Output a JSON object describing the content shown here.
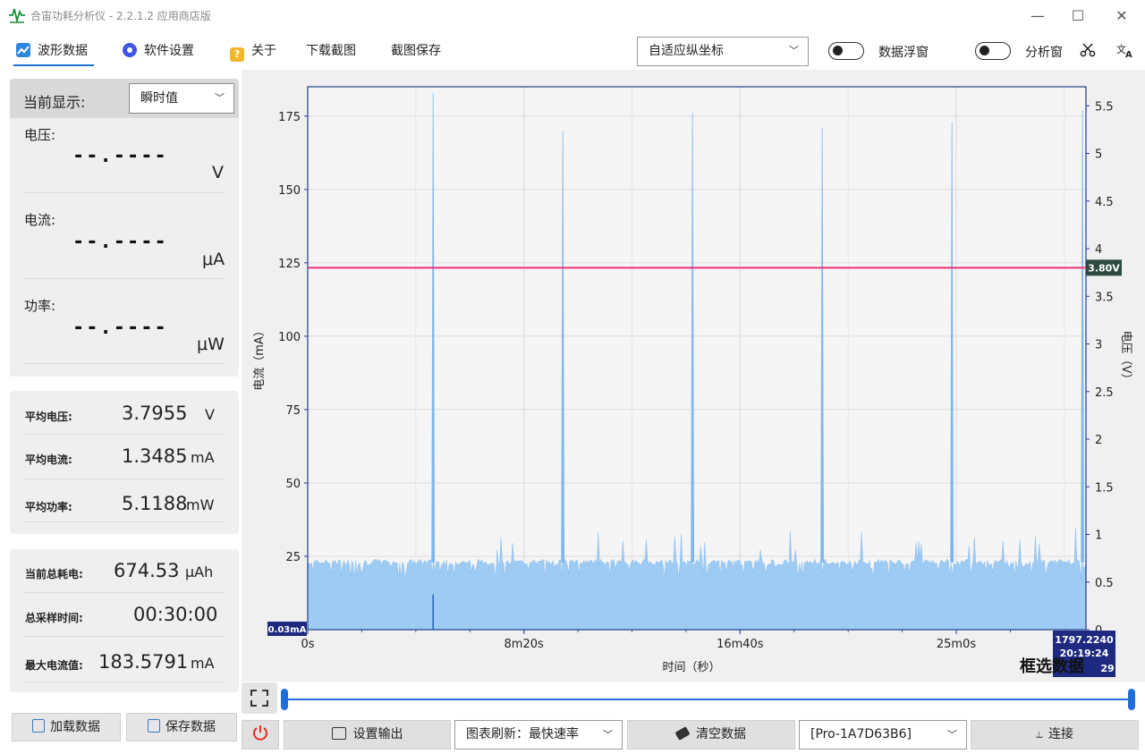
{
  "window": {
    "title": "合宙功耗分析仪 - 2.2.1.2 应用商店版"
  },
  "toolbar": {
    "tabs": [
      {
        "label": "波形数据"
      },
      {
        "label": "软件设置"
      },
      {
        "label": "关于"
      },
      {
        "label": "下载截图"
      },
      {
        "label": "截图保存"
      }
    ],
    "axis_mode": "自适应纵坐标",
    "float_label": "数据浮窗",
    "analysis_label": "分析窗"
  },
  "left": {
    "display_label": "当前显示:",
    "display_mode": "瞬时值",
    "voltage_label": "电压:",
    "voltage_value": "--.----",
    "voltage_unit": "V",
    "current_label": "电流:",
    "current_value": "--.----",
    "current_unit": "μA",
    "power_label": "功率:",
    "power_value": "--.----",
    "power_unit": "μW",
    "avg_voltage_label": "平均电压:",
    "avg_voltage": "3.7955",
    "avg_voltage_unit": "V",
    "avg_current_label": "平均电流:",
    "avg_current": "1.3485",
    "avg_current_unit": "mA",
    "avg_power_label": "平均功率:",
    "avg_power": "5.1188",
    "avg_power_unit": "mW",
    "total_energy_label": "当前总耗电:",
    "total_energy": "674.53",
    "total_energy_unit": "μAh",
    "sample_time_label": "总采样时间:",
    "sample_time": "00:30:00",
    "max_current_label": "最大电流值:",
    "max_current": "183.5791",
    "max_current_unit": "mA",
    "load_button": "加载数据",
    "save_button": "保存数据"
  },
  "chart_data": {
    "type": "area",
    "xlabel": "时间（秒）",
    "ylabel": "电流（mA）",
    "y2label": "电压（V）",
    "x_ticks": [
      "0s",
      "8m20s",
      "16m40s",
      "25m0s"
    ],
    "x_tick_values": [
      0,
      500,
      1000,
      1500
    ],
    "xlim": [
      0,
      1800
    ],
    "y_ticks": [
      25,
      50,
      75,
      100,
      125,
      150,
      175
    ],
    "ylim": [
      0,
      185
    ],
    "y2_ticks": [
      "0",
      "0.5",
      "1",
      "1.5",
      "2",
      "2.5",
      "3",
      "3.5",
      "4",
      "4.5",
      "5",
      "5.5"
    ],
    "y2lim": [
      0,
      5.7
    ],
    "baseline_current_mA": 23,
    "spikes": [
      {
        "x": 290,
        "y": 183
      },
      {
        "x": 590,
        "y": 170
      },
      {
        "x": 890,
        "y": 176
      },
      {
        "x": 1190,
        "y": 171
      },
      {
        "x": 1490,
        "y": 173
      },
      {
        "x": 1792,
        "y": 177
      }
    ],
    "voltage_line": 3.8,
    "voltage_label": "3.80V",
    "min_label": "0.03mA",
    "cursor_label": [
      "1797.2240",
      "20:19:24",
      "29"
    ],
    "overlay_text": "框选数据",
    "colors": {
      "fill": "#9ecbf3",
      "spike": "#7fb8ef",
      "voltage": "#e8337a"
    }
  },
  "bottom": {
    "output_button": "设置输出",
    "refresh_combo": "图表刷新：最快速率",
    "clear_button": "清空数据",
    "device_combo": "[Pro-1A7D63B6]",
    "connect_button": "连接"
  }
}
